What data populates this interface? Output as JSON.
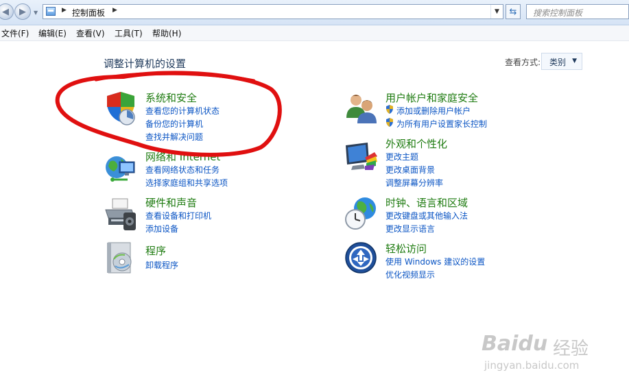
{
  "breadcrumb": {
    "root": "控制面板"
  },
  "search": {
    "placeholder": "搜索控制面板"
  },
  "menu": [
    "文件(F)",
    "编辑(E)",
    "查看(V)",
    "工具(T)",
    "帮助(H)"
  ],
  "page": {
    "title": "调整计算机的设置",
    "view_label": "查看方式:",
    "view_value": "类别"
  },
  "categories": [
    {
      "title": "系统和安全",
      "icon": "shield-security-icon",
      "links": [
        "查看您的计算机状态",
        "备份您的计算机",
        "查找并解决问题"
      ]
    },
    {
      "title": "网络和 Internet",
      "icon": "network-globe-icon",
      "links": [
        "查看网络状态和任务",
        "选择家庭组和共享选项"
      ]
    },
    {
      "title": "硬件和声音",
      "icon": "printer-icon",
      "links": [
        "查看设备和打印机",
        "添加设备"
      ]
    },
    {
      "title": "程序",
      "icon": "programs-disc-icon",
      "links": [
        "卸载程序"
      ]
    },
    {
      "title": "用户帐户和家庭安全",
      "icon": "users-icon",
      "links": [
        "添加或删除用户帐户",
        "为所有用户设置家长控制"
      ]
    },
    {
      "title": "外观和个性化",
      "icon": "monitor-paint-icon",
      "links": [
        "更改主题",
        "更改桌面背景",
        "调整屏幕分辨率"
      ]
    },
    {
      "title": "时钟、语言和区域",
      "icon": "clock-globe-icon",
      "links": [
        "更改键盘或其他输入法",
        "更改显示语言"
      ]
    },
    {
      "title": "轻松访问",
      "icon": "ease-of-access-icon",
      "links": [
        "使用 Windows 建议的设置",
        "优化视频显示"
      ]
    }
  ],
  "watermark": {
    "brand": "Baidu",
    "brand_cn": "经验",
    "url": "jingyan.baidu.com"
  },
  "colors": {
    "category_title": "#1e7b10",
    "link": "#0b55c4",
    "annotation": "#e01010"
  }
}
